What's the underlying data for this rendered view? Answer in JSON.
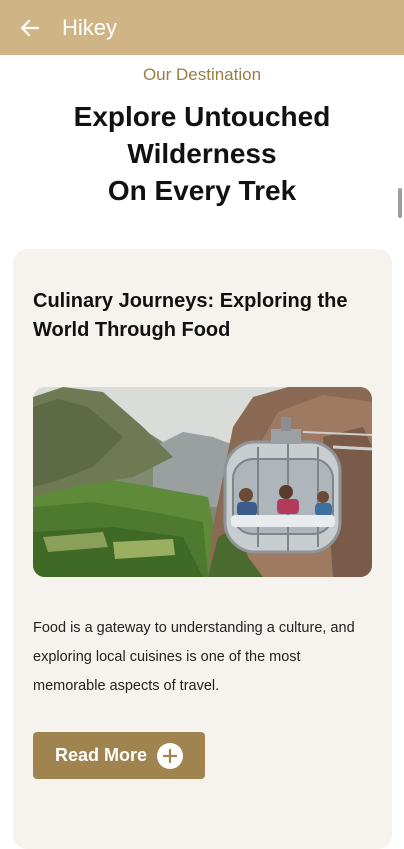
{
  "app_bar": {
    "title": "Hikey",
    "back_icon": "arrow-left-icon",
    "background": "#cfb485"
  },
  "hero": {
    "eyebrow": "Our Destination",
    "headline": "Explore Untouched\nWilderness\nOn Every Trek"
  },
  "card": {
    "title": "Culinary Journeys: Exploring the World Through Food",
    "image_alt": "Transparent glass sky capsule pod with people inside, hanging on a cliff above a green valley",
    "description": "Food is a gateway to understanding a culture, and exploring local cuisines is one of the most memorable aspects of travel.",
    "button_label": "Read More",
    "button_icon": "plus-circle-icon"
  },
  "colors": {
    "accent": "#9a7d45",
    "button": "#a0844f",
    "card_bg": "#f6f3ee"
  }
}
